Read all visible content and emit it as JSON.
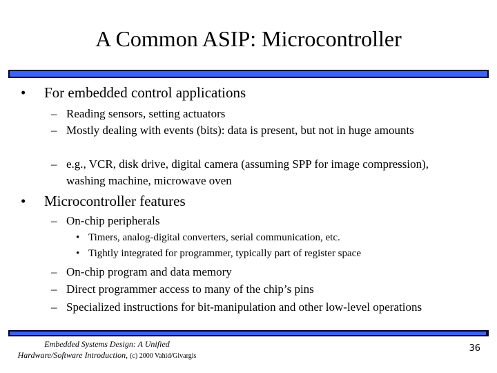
{
  "slide": {
    "title": "A Common ASIP: Microcontroller",
    "bullets": [
      {
        "text": "For embedded control applications",
        "sub": [
          {
            "text": "Reading sensors, setting actuators"
          },
          {
            "text": "Mostly dealing with events (bits): data is present, but not in huge amounts"
          },
          {
            "text": "e.g., VCR, disk drive, digital camera (assuming SPP for image compression), washing machine, microwave oven"
          }
        ]
      },
      {
        "text": "Microcontroller features",
        "sub": [
          {
            "text": "On-chip peripherals",
            "sub": [
              {
                "text": "Timers, analog-digital converters, serial communication, etc."
              },
              {
                "text": "Tightly integrated for programmer, typically part of register space"
              }
            ]
          },
          {
            "text": "On-chip program and data memory"
          },
          {
            "text": "Direct programmer access to many of the chip’s pins"
          },
          {
            "text": "Specialized instructions for bit-manipulation and other low-level operations"
          }
        ]
      }
    ],
    "bullet_glyph": "•",
    "dash_glyph": "–",
    "sub_bullet_glyph": "•"
  },
  "footer": {
    "line1": "Embedded Systems Design: A Unified",
    "line2": "Hardware/Software Introduction,",
    "copyright": "(c) 2000 Vahid/Givargis",
    "page_number": "36"
  },
  "colors": {
    "bar_fill": "#3b64f0",
    "bar_border": "#000033"
  }
}
